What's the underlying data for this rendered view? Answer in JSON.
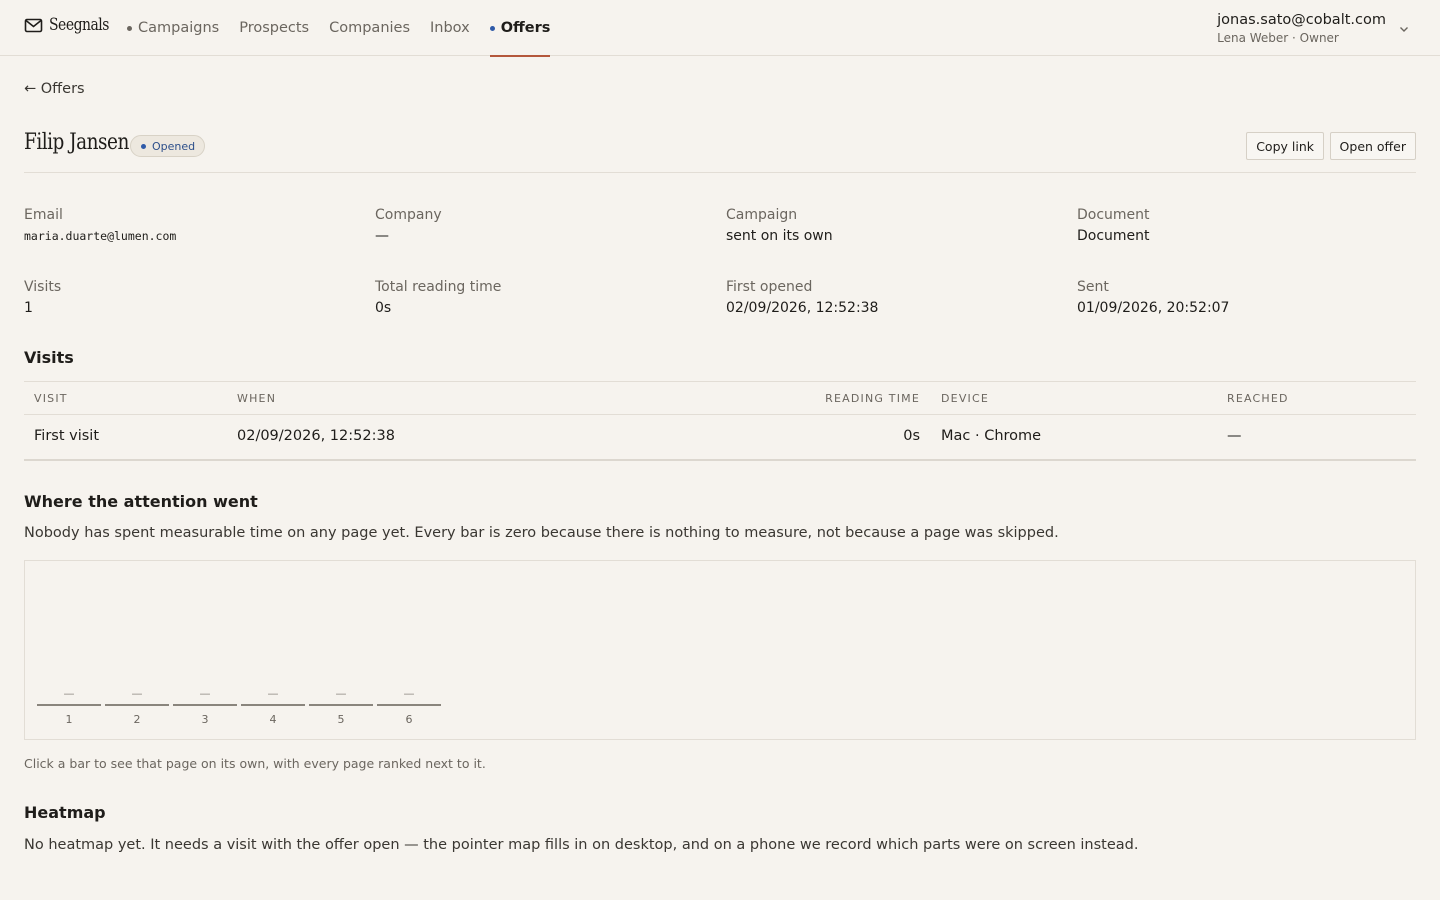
{
  "brand": {
    "name": "Seegnals",
    "icon": "envelope-icon"
  },
  "nav": {
    "items": [
      {
        "label": "Campaigns",
        "dot": "#6b665f",
        "active": false
      },
      {
        "label": "Prospects",
        "active": false
      },
      {
        "label": "Companies",
        "active": false
      },
      {
        "label": "Inbox",
        "active": false
      },
      {
        "label": "Offers",
        "dot": "#2f5aa8",
        "active": true
      }
    ],
    "accent": "#b4573b"
  },
  "account": {
    "email": "jonas.sato@cobalt.com",
    "role": "Lena Weber · Owner"
  },
  "back_link": "← Offers",
  "offer": {
    "name": "Filip Jansen",
    "status": "Opened",
    "status_color": "#2f5aa8",
    "actions": {
      "copy": "Copy link",
      "open": "Open offer"
    }
  },
  "details": {
    "email": {
      "label": "Email",
      "value": "maria.duarte@lumen.com"
    },
    "company": {
      "label": "Company",
      "value": "—"
    },
    "campaign": {
      "label": "Campaign",
      "value": "sent on its own"
    },
    "document": {
      "label": "Document",
      "value": "Document"
    },
    "visits": {
      "label": "Visits",
      "value": "1"
    },
    "reading": {
      "label": "Total reading time",
      "value": "0s"
    },
    "first_opened": {
      "label": "First opened",
      "value": "02/09/2026, 12:52:38"
    },
    "sent": {
      "label": "Sent",
      "value": "01/09/2026, 20:52:07"
    }
  },
  "visits_section": {
    "title": "Visits",
    "columns": [
      "VISIT",
      "WHEN",
      "READING TIME",
      "DEVICE",
      "REACHED"
    ],
    "rows": [
      {
        "visit": "First visit",
        "when": "02/09/2026, 12:52:38",
        "reading": "0s",
        "device": "Mac · Chrome",
        "reached": "—"
      }
    ]
  },
  "attention": {
    "title": "Where the attention went",
    "description": "Nobody has spent measurable time on any page yet. Every bar is zero because there is nothing to measure, not because a page was skipped.",
    "hint": "Click a bar to see that page on its own, with every page ranked next to it."
  },
  "chart_data": {
    "type": "bar",
    "categories": [
      "1",
      "2",
      "3",
      "4",
      "5",
      "6"
    ],
    "values": [
      0,
      0,
      0,
      0,
      0,
      0
    ],
    "labels": [
      "—",
      "—",
      "—",
      "—",
      "—",
      "—"
    ],
    "bar_color": "#8a857d"
  },
  "heatmap": {
    "title": "Heatmap",
    "description": "No heatmap yet. It needs a visit with the offer open — the pointer map fills in on desktop, and on a phone we record which parts were on screen instead."
  }
}
